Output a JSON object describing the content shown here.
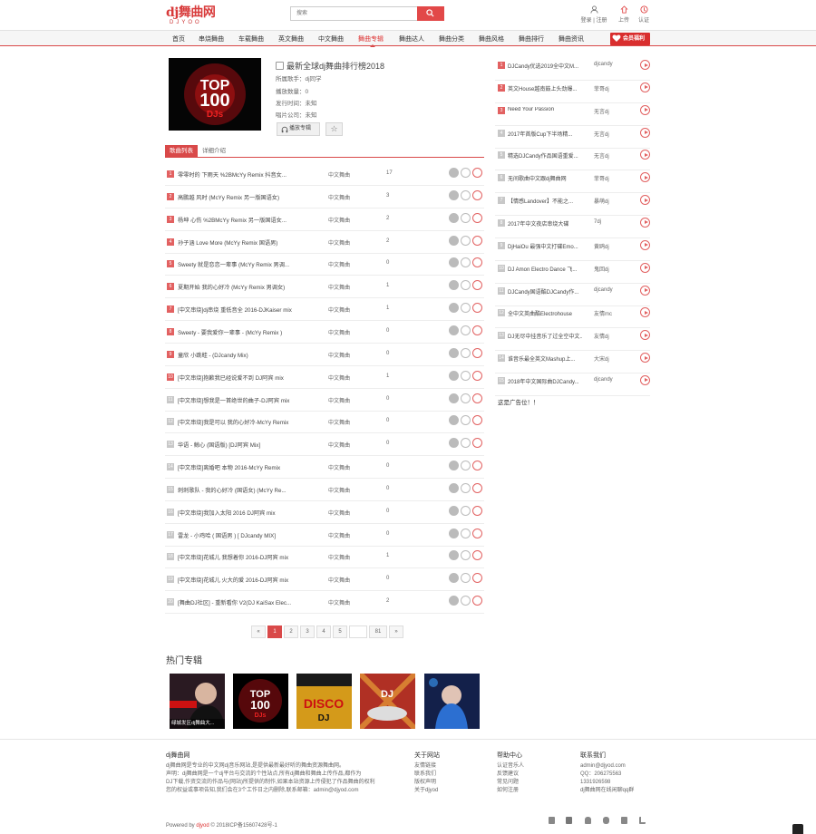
{
  "header": {
    "logo_text": "dj舞曲网",
    "logo_sub": "DJYOO",
    "search_placeholder": "搜索",
    "icons": [
      {
        "label": "登录 | 注册",
        "icon": "user-icon"
      },
      {
        "label": "上传",
        "icon": "upload-icon"
      },
      {
        "label": "认证",
        "icon": "badge-icon"
      }
    ]
  },
  "nav": {
    "items": [
      "首页",
      "串烧舞曲",
      "车载舞曲",
      "英文舞曲",
      "中文舞曲",
      "舞曲专辑",
      "舞曲达人",
      "舞曲分类",
      "舞曲风格",
      "舞曲排行",
      "舞曲资讯"
    ],
    "active": "舞曲专辑",
    "vip_label": "会员福利",
    "accent": "#d94949"
  },
  "album": {
    "title": "最新全球dj舞曲排行榜2018",
    "cover_text_top": "TOP",
    "cover_text_num": "100",
    "cover_text_djs": "DJs",
    "singer": "所属歌手：dj同学",
    "plays": "播放数量：0",
    "date": "发行时间：未知",
    "company": "唱片公司：未知",
    "play_btn": "播放专辑",
    "fav_btn": "☆"
  },
  "tabs": {
    "songs": "歌曲列表",
    "intro": "详细介绍"
  },
  "songs": [
    {
      "n": "1",
      "name": "零零时的 下雨天 %2BMcYy Remix 抖音女...",
      "cat": "中文舞曲",
      "cnt": "17"
    },
    {
      "n": "2",
      "name": "高鹏越 风时 (McYy Remix 另一版国语女)",
      "cat": "中文舞曲",
      "cnt": "3"
    },
    {
      "n": "3",
      "name": "杨坤 心伤 %2BMcYy Remix 另一版国语女...",
      "cat": "中文舞曲",
      "cnt": "2"
    },
    {
      "n": "4",
      "name": "孙子涵 Love More (McYy Remix 国语男)",
      "cat": "中文舞曲",
      "cnt": "2"
    },
    {
      "n": "5",
      "name": "Sweety 就是恋恋一辈事 (McYy Remix 男调...",
      "cat": "中文舞曲",
      "cnt": "0"
    },
    {
      "n": "6",
      "name": "夏期开始 我的心好冷 (McYy Remix 男调女)",
      "cat": "中文舞曲",
      "cnt": "1"
    },
    {
      "n": "7",
      "name": "[中文串烧]dj串烧 重低音全 2016-DJKaiser mix",
      "cat": "中文舞曲",
      "cnt": "1"
    },
    {
      "n": "8",
      "name": "Sweety - 要我爱你一辈事 - (McYy Remix )",
      "cat": "中文舞曲",
      "cnt": "0"
    },
    {
      "n": "9",
      "name": "童欣 小跳蛙 - (DJcandy Mix)",
      "cat": "中文舞曲",
      "cnt": "0"
    },
    {
      "n": "10",
      "name": "[中文串烧]抱歉我已经说爱不到 DJ阿宾 mix",
      "cat": "中文舞曲",
      "cnt": "1"
    },
    {
      "n": "11",
      "name": "[中文串烧]想我是一首绝世的曲子-DJ阿宾 mix",
      "cat": "中文舞曲",
      "cnt": "0"
    },
    {
      "n": "12",
      "name": "[中文串烧]我是可以 我的心好冷-McYy Remix",
      "cat": "中文舞曲",
      "cnt": "0"
    },
    {
      "n": "13",
      "name": "华语 - 鲸心 (国语版) [DJ阿宾 Mix]",
      "cat": "中文舞曲",
      "cnt": "0"
    },
    {
      "n": "14",
      "name": "[中文串烧]离婚吧 本物 2016-McYy Remix",
      "cat": "中文舞曲",
      "cnt": "0"
    },
    {
      "n": "15",
      "name": "刺刺歌队 - 我的心好冷 (国语女) (McYy Re...",
      "cat": "中文舞曲",
      "cnt": "0"
    },
    {
      "n": "16",
      "name": "[中文串烧]我加入太阳 2016 DJ阿宾 mix",
      "cat": "中文舞曲",
      "cnt": "0"
    },
    {
      "n": "17",
      "name": "雷龙 - 小鸡哈 ( 国语男 ) [ DJcandy MIX]",
      "cat": "中文舞曲",
      "cnt": "0"
    },
    {
      "n": "18",
      "name": "[中文串烧]花城儿 我想着你 2016-DJ阿宾 mix",
      "cat": "中文舞曲",
      "cnt": "1"
    },
    {
      "n": "19",
      "name": "[中文串烧]花城儿 火大的爱 2016-DJ阿宾 mix",
      "cat": "中文舞曲",
      "cnt": "0"
    },
    {
      "n": "20",
      "name": "[舞曲DJ社区] - 重新看你 V2(DJ KaiSax Elec...",
      "cat": "中文舞曲",
      "cnt": "2"
    }
  ],
  "pager": {
    "prev": "«",
    "pages": [
      "1",
      "2",
      "3",
      "4",
      "5"
    ],
    "ellipsis": "",
    "last": "81",
    "next": "»"
  },
  "ranking": [
    {
      "n": "1",
      "name": "DJCandy优选2019全中文M...",
      "author": "djcandy"
    },
    {
      "n": "2",
      "name": "英文House越南鼓上头劲爆...",
      "author": "菲哥dj"
    },
    {
      "n": "3",
      "name": "Need Your Passion",
      "author": "无言dj"
    },
    {
      "n": "4",
      "name": "2017年首版Cup下半场精...",
      "author": "无言dj"
    },
    {
      "n": "5",
      "name": "精选DJCandy作品国语重爱...",
      "author": "无言dj"
    },
    {
      "n": "6",
      "name": "无间歌曲中文跟dj舞曲网",
      "author": "菲哥dj"
    },
    {
      "n": "7",
      "name": "【情感Landover】不能之...",
      "author": "暴萌dj"
    },
    {
      "n": "8",
      "name": "2017年中文夜店串烧大碟",
      "author": "7dj"
    },
    {
      "n": "9",
      "name": "DjHaiOu 最强中文打碟Emo...",
      "author": "黄鸥dj"
    },
    {
      "n": "10",
      "name": "DJ Amon Electro Dance 飞...",
      "author": "鬼回dj"
    },
    {
      "n": "11",
      "name": "DJCandy国语酷DJCandy作...",
      "author": "djcandy"
    },
    {
      "n": "12",
      "name": "全中文英曲酷Electrohouse",
      "author": "友情mc"
    },
    {
      "n": "13",
      "name": "DJ无尽中挂音乐了过全空中文...",
      "author": "友情dj"
    },
    {
      "n": "14",
      "name": "谁音乐最全英文Mashup上...",
      "author": "大宋dj"
    },
    {
      "n": "15",
      "name": "2018年中文国际曲DJCandy...",
      "author": "djcandy"
    }
  ],
  "ad_text": "这是广告位！！",
  "hot": {
    "title": "热门专辑",
    "items": [
      {
        "caption": "绿城发区dj舞曲大...",
        "color": "#2a1a22"
      },
      {
        "caption": "",
        "color": "#000000"
      },
      {
        "caption": "",
        "color": "#d49a1a"
      },
      {
        "caption": "",
        "color": "#b03024"
      },
      {
        "caption": "",
        "color": "#13204a"
      }
    ]
  },
  "footer": {
    "site_title": "dj舞曲网",
    "about_lines": [
      "dj舞曲网是专业的中文网dj音乐网站,是提供最新最好听的舞曲资源舞曲网。",
      "声明：dj舞曲网是一个dj平台与交流的个性站点,所有dj舞曲和舞曲上传作品,都作为",
      "DJ下载,作资交流的作品与(网站)所提供的制作,如果本站资源上传侵犯了作品舞曲的权利",
      "您的权益或事项告知,我们会在3个工作日之内删除,联系邮箱：admin@djyod.com"
    ],
    "cols": [
      {
        "title": "关于网站",
        "items": [
          "友情链接",
          "联系我们",
          "版权声明",
          "关于djyod"
        ]
      },
      {
        "title": "帮助中心",
        "items": [
          "认证音乐人",
          "反馈建议",
          "常见问题",
          "如何注册"
        ]
      },
      {
        "title": "联系我们",
        "items": [
          "admin@djyod.com",
          "QQ：206275563",
          "1331926598",
          "dj舞曲网在线闲聊qq群"
        ]
      }
    ],
    "copyright_pre": "Powered by",
    "copyright_brand": "djyod",
    "copyright_post": "© 2018ICP备15607428号-1"
  }
}
